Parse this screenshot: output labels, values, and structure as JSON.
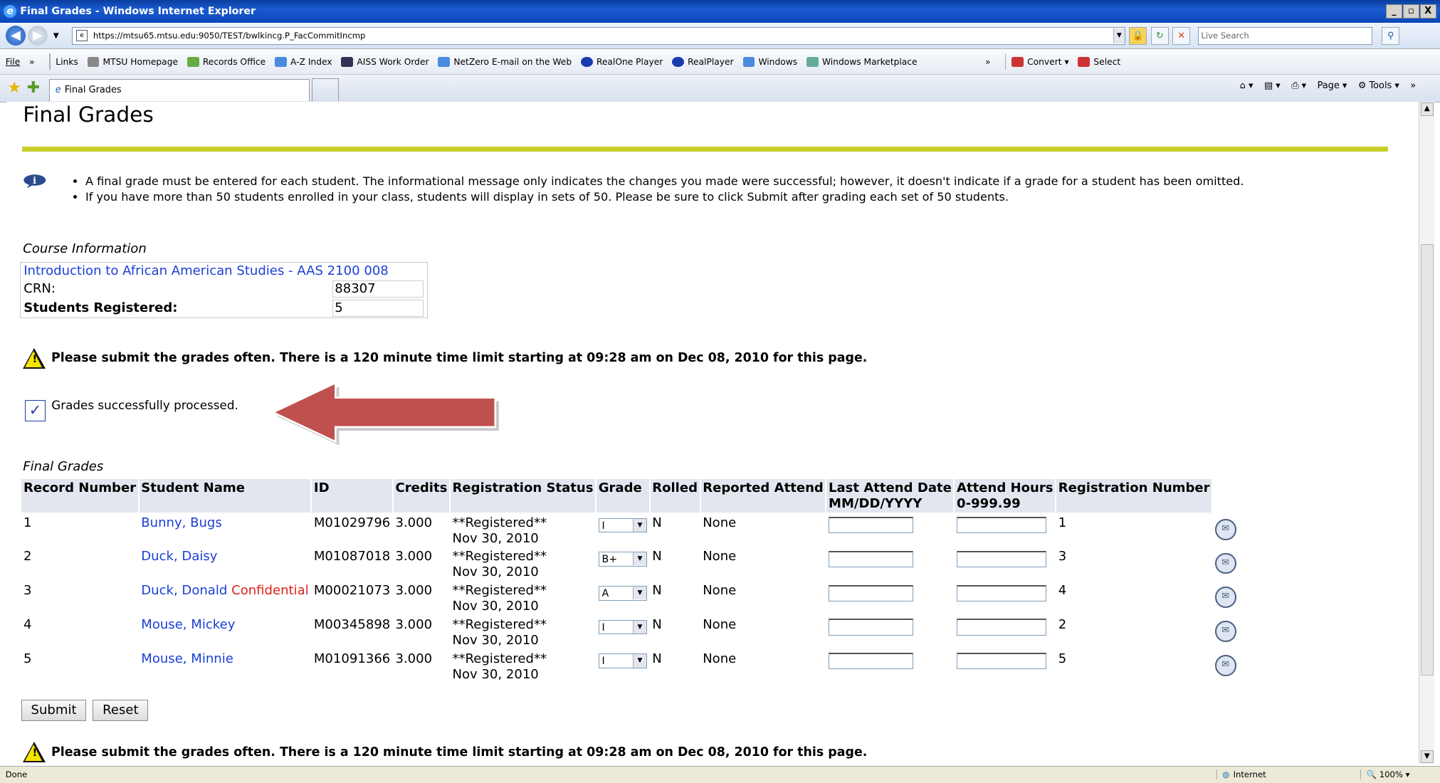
{
  "window": {
    "title": "Final Grades - Windows Internet Explorer",
    "buttons": [
      "_",
      "▫",
      "X"
    ]
  },
  "address": {
    "url": "https://mtsu65.mtsu.edu:9050/TEST/bwlkincg.P_FacCommitIncmp",
    "search_placeholder": "Live Search"
  },
  "links_bar": {
    "file": "File",
    "links_label": "Links",
    "items": [
      "MTSU Homepage",
      "Records Office",
      "A-Z Index",
      "AISS Work Order",
      "NetZero E-mail on the Web",
      "RealOne Player",
      "RealPlayer",
      "Windows",
      "Windows Marketplace"
    ],
    "convert": "Convert",
    "select": "Select"
  },
  "tab": {
    "label": "Final Grades"
  },
  "toolbar": {
    "page": "Page",
    "tools": "Tools"
  },
  "page": {
    "title": "Final Grades",
    "messages": [
      "A final grade must be entered for each student. The informational message only indicates the changes you made were successful; however, it doesn't indicate if a grade for a student has been omitted.",
      "If you have more than 50 students enrolled in your class, students will display in sets of 50. Please be sure to click Submit after grading each set of 50 students."
    ],
    "course_info_heading": "Course Information",
    "course_title": "Introduction to African American Studies - AAS 2100 008",
    "crn_label": "CRN:",
    "crn": "88307",
    "registered_label": "Students Registered:",
    "registered": "5",
    "warning": "Please submit the grades often. There is a 120 minute time limit starting at 09:28 am on Dec 08, 2010 for this page.",
    "success": "Grades successfully processed.",
    "final_grades_heading": "Final Grades",
    "headers": [
      "Record Number",
      "Student Name",
      "ID",
      "Credits",
      "Registration Status",
      "Grade",
      "Rolled",
      "Reported Attend",
      "Last Attend Date",
      "Attend Hours",
      "Registration Number"
    ],
    "headers_sub": {
      "last_attend": "MM/DD/YYYY",
      "attend_hours": "0-999.99"
    },
    "rows": [
      {
        "rec": "1",
        "name": "Bunny, Bugs",
        "conf": "",
        "id": "M01029796",
        "credits": "3.000",
        "status": "**Registered**",
        "date": "Nov 30, 2010",
        "grade": "I",
        "rolled": "N",
        "reported": "None",
        "regnum": "1"
      },
      {
        "rec": "2",
        "name": "Duck, Daisy",
        "conf": "",
        "id": "M01087018",
        "credits": "3.000",
        "status": "**Registered**",
        "date": "Nov 30, 2010",
        "grade": "B+",
        "rolled": "N",
        "reported": "None",
        "regnum": "3"
      },
      {
        "rec": "3",
        "name": "Duck, Donald",
        "conf": "Confidential",
        "id": "M00021073",
        "credits": "3.000",
        "status": "**Registered**",
        "date": "Nov 30, 2010",
        "grade": "A",
        "rolled": "N",
        "reported": "None",
        "regnum": "4"
      },
      {
        "rec": "4",
        "name": "Mouse, Mickey",
        "conf": "",
        "id": "M00345898",
        "credits": "3.000",
        "status": "**Registered**",
        "date": "Nov 30, 2010",
        "grade": "I",
        "rolled": "N",
        "reported": "None",
        "regnum": "2"
      },
      {
        "rec": "5",
        "name": "Mouse, Minnie",
        "conf": "",
        "id": "M01091366",
        "credits": "3.000",
        "status": "**Registered**",
        "date": "Nov 30, 2010",
        "grade": "I",
        "rolled": "N",
        "reported": "None",
        "regnum": "5"
      }
    ],
    "submit": "Submit",
    "reset": "Reset"
  },
  "status": {
    "left": "Done",
    "zone": "Internet",
    "zoom": "100%"
  }
}
